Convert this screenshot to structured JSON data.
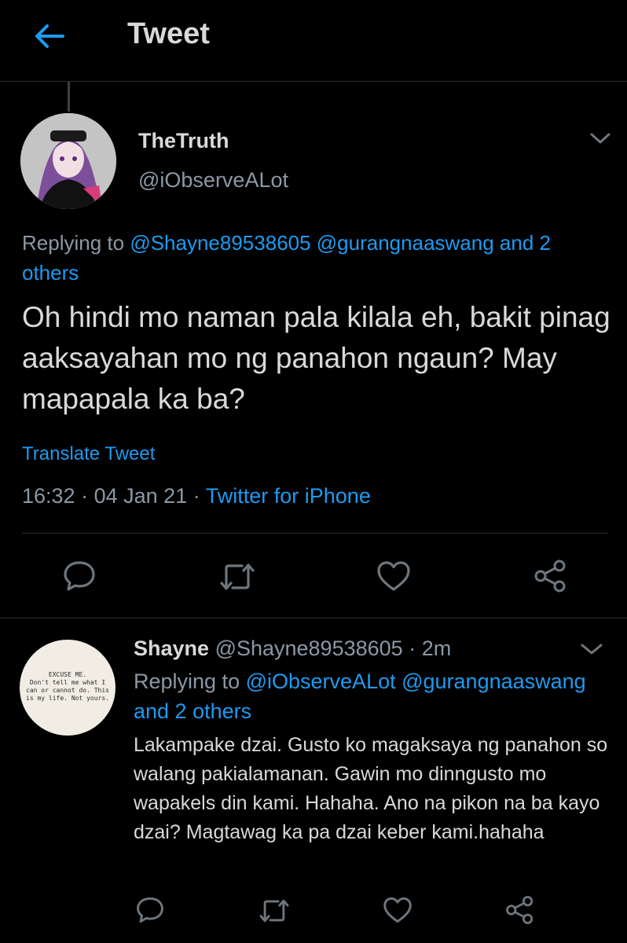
{
  "header": {
    "title": "Tweet"
  },
  "main_tweet": {
    "display_name": "TheTruth",
    "handle": "@iObserveALot",
    "reply_prefix": "Replying to",
    "reply_targets": "@Shayne89538605 @gurangnaaswang and 2 others",
    "text": "Oh hindi mo naman pala kilala eh, bakit pinag aaksayahan mo ng panahon ngaun? May mapapala ka ba?",
    "translate_label": "Translate Tweet",
    "time": "16:32",
    "sep": "·",
    "date": "04 Jan 21",
    "source": "Twitter for iPhone"
  },
  "reply_tweet": {
    "display_name": "Shayne",
    "handle": "@Shayne89538605",
    "sep": "·",
    "time_ago": "2m",
    "reply_prefix": "Replying to",
    "reply_targets": "@iObserveALot @gurangnaaswang",
    "reply_suffix": "and 2 others",
    "text": "Lakampake dzai. Gusto ko magaksaya ng panahon so walang pakialamanan. Gawin mo dinngusto mo wapakels din kami. Hahaha. Ano na pikon na ba kayo dzai? Magtawag ka pa dzai keber kami.hahaha",
    "avatar_text": [
      "EXCUSE ME.",
      "Don't tell me what I",
      "can or cannot do. This",
      "is my life. Not yours."
    ]
  },
  "icons": {
    "back": "arrow-left-icon",
    "menu": "chevron-down-icon",
    "reply": "comment-icon",
    "retweet": "retweet-icon",
    "like": "heart-icon",
    "share": "share-icon"
  },
  "colors": {
    "background": "#000000",
    "accent": "#1d9bf0",
    "text_primary": "#d9d9d9",
    "text_secondary": "#8b98a5",
    "divider": "#2a2e33"
  }
}
